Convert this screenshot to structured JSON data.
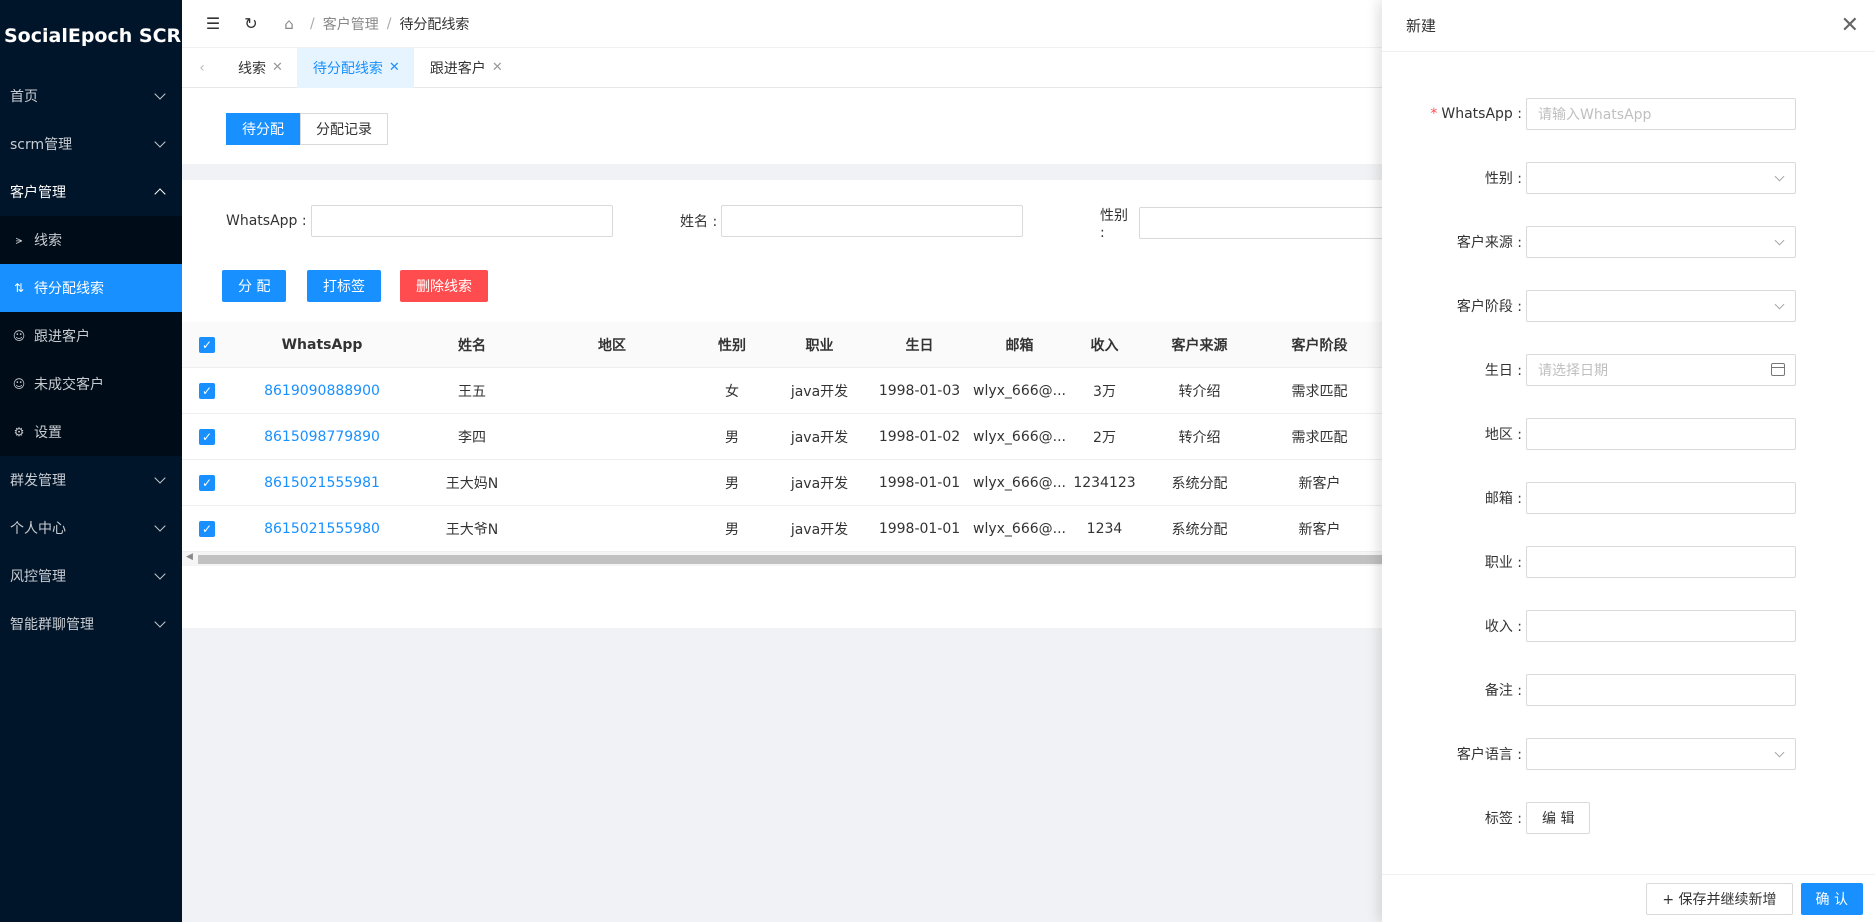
{
  "app": {
    "title": "SocialEpoch SCRM"
  },
  "sidebar": {
    "menus": [
      {
        "label": "首页"
      },
      {
        "label": "scrm管理"
      },
      {
        "label": "客户管理"
      }
    ],
    "sub_items": [
      {
        "label": "线索",
        "icon": "share-icon"
      },
      {
        "label": "待分配线索",
        "icon": "swap-icon"
      },
      {
        "label": "跟进客户",
        "icon": "user-icon"
      },
      {
        "label": "未成交客户",
        "icon": "user-icon"
      },
      {
        "label": "设置",
        "icon": "gear-icon"
      }
    ],
    "menus_after": [
      {
        "label": "群发管理"
      },
      {
        "label": "个人中心"
      },
      {
        "label": "风控管理"
      },
      {
        "label": "智能群聊管理"
      }
    ]
  },
  "breadcrumb": {
    "sep": "/",
    "items": [
      "客户管理",
      "待分配线索"
    ]
  },
  "tabs": [
    {
      "label": "线索"
    },
    {
      "label": "待分配线索"
    },
    {
      "label": "跟进客户"
    }
  ],
  "segment": {
    "items": [
      "待分配",
      "分配记录"
    ]
  },
  "filters": [
    {
      "label": "WhatsApp :"
    },
    {
      "label": "姓名 :"
    },
    {
      "label": "性别 :"
    }
  ],
  "actions": {
    "assign": "分 配",
    "tag": "打标签",
    "delete": "删除线索"
  },
  "table": {
    "headers": [
      "WhatsApp",
      "姓名",
      "地区",
      "性别",
      "职业",
      "生日",
      "邮箱",
      "收入",
      "客户来源",
      "客户阶段"
    ],
    "rows": [
      {
        "whatsapp": "8619090888900",
        "name": "王五",
        "region": "",
        "gender": "女",
        "job": "java开发",
        "birthday": "1998-01-03",
        "email": "wlyx_666@...",
        "income": "3万",
        "source": "转介绍",
        "stage": "需求匹配"
      },
      {
        "whatsapp": "8615098779890",
        "name": "李四",
        "region": "",
        "gender": "男",
        "job": "java开发",
        "birthday": "1998-01-02",
        "email": "wlyx_666@...",
        "income": "2万",
        "source": "转介绍",
        "stage": "需求匹配"
      },
      {
        "whatsapp": "8615021555981",
        "name": "王大妈N",
        "region": "",
        "gender": "男",
        "job": "java开发",
        "birthday": "1998-01-01",
        "email": "wlyx_666@...",
        "income": "1234123",
        "source": "系统分配",
        "stage": "新客户"
      },
      {
        "whatsapp": "8615021555980",
        "name": "王大爷N",
        "region": "",
        "gender": "男",
        "job": "java开发",
        "birthday": "1998-01-01",
        "email": "wlyx_666@...",
        "income": "1234",
        "source": "系统分配",
        "stage": "新客户"
      }
    ]
  },
  "drawer": {
    "title": "新建",
    "fields": [
      {
        "label": "WhatsApp :",
        "required": "*",
        "placeholder": "请输入WhatsApp",
        "type": "input"
      },
      {
        "label": "性别 :",
        "type": "select"
      },
      {
        "label": "客户来源 :",
        "type": "select"
      },
      {
        "label": "客户阶段 :",
        "type": "select"
      },
      {
        "label": "生日 :",
        "placeholder": "请选择日期",
        "type": "date"
      },
      {
        "label": "地区 :",
        "type": "input"
      },
      {
        "label": "邮箱 :",
        "type": "input"
      },
      {
        "label": "职业 :",
        "type": "input"
      },
      {
        "label": "收入 :",
        "type": "input"
      },
      {
        "label": "备注 :",
        "type": "input"
      },
      {
        "label": "客户语言 :",
        "type": "select"
      },
      {
        "label": "标签 :",
        "type": "button",
        "button_label": "编 辑"
      }
    ],
    "footer": {
      "save_continue": "+ 保存并继续新增",
      "confirm": "确 认"
    }
  }
}
